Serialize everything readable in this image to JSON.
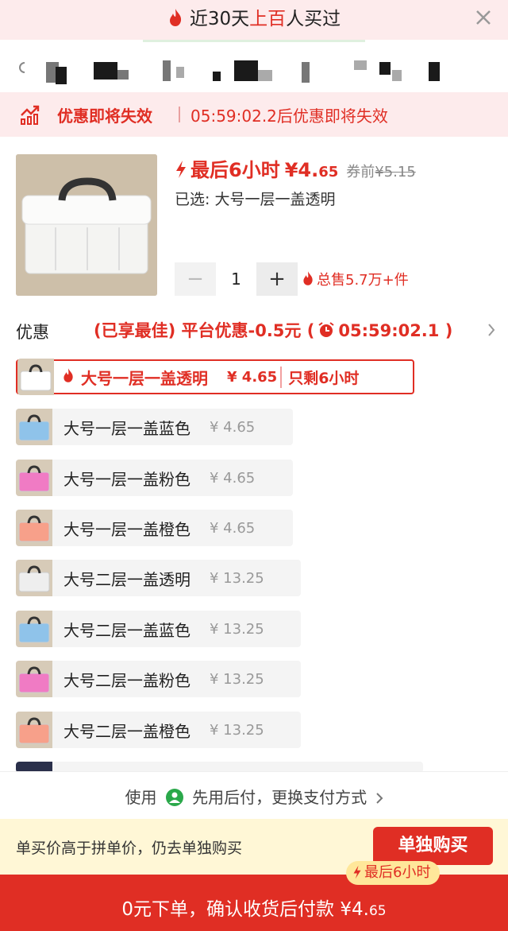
{
  "top_banner": {
    "title_prefix": "近30天",
    "title_highlight": "上百",
    "title_suffix": "人买过",
    "fire_icon": "fire-icon",
    "close_icon": "close-icon"
  },
  "offer_expiry": {
    "label": "优惠即将失效",
    "countdown_text": "05:59:02.2后优惠即将失效",
    "icon": "trend-up-icon"
  },
  "product": {
    "price_prefix": "最后6小时",
    "price_main": "¥4.",
    "price_decimal": "65",
    "before_label": "券前",
    "before_price": "¥5.15",
    "selected": "已选: 大号一层一盖透明",
    "quantity": "1",
    "minus_label": "−",
    "plus_label": "+",
    "sold": "总售5.7万+件"
  },
  "promo": {
    "label": "优惠",
    "value_prefix": "(已享最佳) 平台优惠-0.5元 (",
    "countdown": "05:59:02.1 )"
  },
  "skus": [
    {
      "name": "大号一层一盖透明",
      "price": "¥ 4.65",
      "remaining": "只剩6小时",
      "color": "#ffffff",
      "active": true
    },
    {
      "name": "大号一层一盖蓝色",
      "price": "¥ 4.65",
      "color": "#8fc3ea"
    },
    {
      "name": "大号一层一盖粉色",
      "price": "¥ 4.65",
      "color": "#f07bc4"
    },
    {
      "name": "大号一层一盖橙色",
      "price": "¥ 4.65",
      "color": "#f7a08a"
    },
    {
      "name": "大号二层一盖透明",
      "price": "¥ 13.25",
      "color": "#eeeeee"
    },
    {
      "name": "大号二层一盖蓝色",
      "price": "¥ 13.25",
      "color": "#8fc3ea"
    },
    {
      "name": "大号二层一盖粉色",
      "price": "¥ 13.25",
      "color": "#f07bc4"
    },
    {
      "name": "大号二层一盖橙色",
      "price": "¥ 13.25",
      "color": "#f7a08a"
    }
  ],
  "pay_hint": {
    "before": "使用",
    "after": "先用后付，更换支付方式",
    "chevron": "chevron-right-icon"
  },
  "bottom": {
    "hint": "单买价高于拼单价，仍去单独购买",
    "alone_button": "单独购买",
    "tag": "最后6小时",
    "confirm_prefix": "0元下单，确认收货后付款 ¥4.",
    "confirm_decimal": "65"
  },
  "colors": {
    "accent": "#e02e24",
    "pink_bg": "#fdebec",
    "yellow_bg": "#fff7d6"
  }
}
